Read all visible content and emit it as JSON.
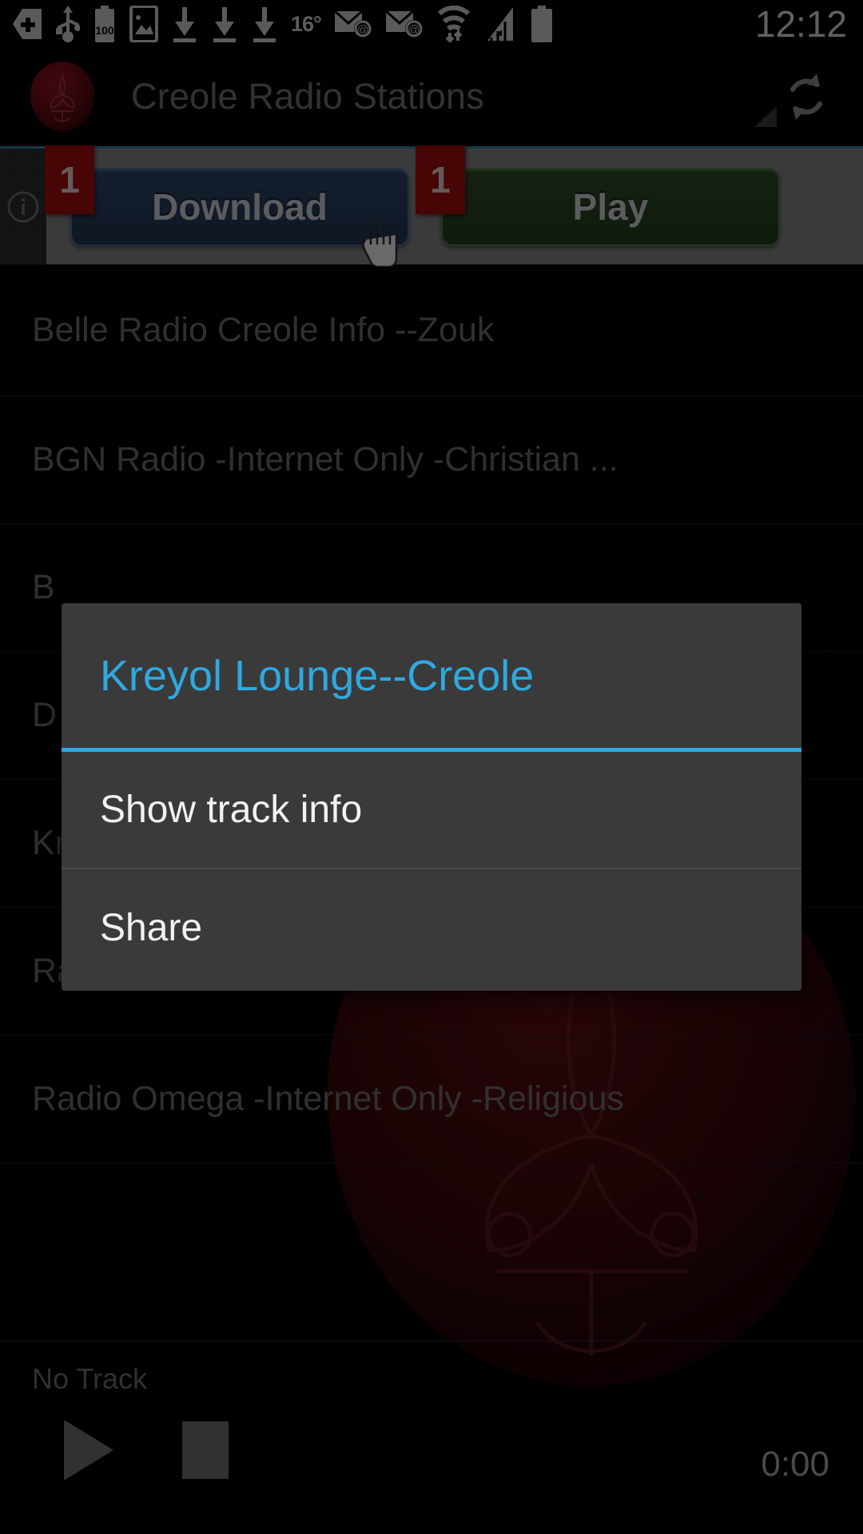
{
  "status_bar": {
    "icons": [
      {
        "name": "shield-plus-icon"
      },
      {
        "name": "usb-icon"
      },
      {
        "name": "battery-100-icon",
        "label": "100"
      },
      {
        "name": "screenshot-image-icon"
      },
      {
        "name": "download-icon"
      },
      {
        "name": "download-icon"
      },
      {
        "name": "download-icon"
      }
    ],
    "temperature": "16°",
    "mail_icons": [
      {
        "name": "email-icon"
      },
      {
        "name": "email-icon"
      }
    ],
    "wifi_icon": "wifi-data-icon",
    "signal_icon": "cellular-signal-icon",
    "battery_icon": "battery-icon",
    "clock": "12:12"
  },
  "action_bar": {
    "logo_icon": "wax-seal-logo-icon",
    "title": "Creole Radio Stations",
    "overflow_icon": "overflow-triangle-icon",
    "refresh_icon": "refresh-icon"
  },
  "ad_banner": {
    "info_icon": "ad-info-icon",
    "cursor_icon": "hand-cursor-icon",
    "buttons": [
      {
        "label": "Download",
        "badge": "1",
        "name": "download"
      },
      {
        "label": "Play",
        "badge": "1",
        "name": "play"
      }
    ]
  },
  "station_list": {
    "items": [
      {
        "label": "Belle Radio Creole Info --Zouk"
      },
      {
        "label": "BGN Radio -Internet Only -Christian ..."
      },
      {
        "label": "B"
      },
      {
        "label": "D"
      },
      {
        "label": "Kreyol Lounge --Creole"
      },
      {
        "label": "Radio Harmony FM -Jacmel Haiti -W..."
      },
      {
        "label": "Radio Omega -Internet Only -Religious"
      }
    ]
  },
  "context_dialog": {
    "title": "Kreyol Lounge--Creole",
    "accent_color": "#2fa8e0",
    "items": [
      {
        "label": "Show track info"
      },
      {
        "label": "Share"
      }
    ]
  },
  "player_bar": {
    "track_name": "No Track",
    "play_icon": "play-icon",
    "stop_icon": "stop-icon",
    "elapsed_time": "0:00"
  }
}
